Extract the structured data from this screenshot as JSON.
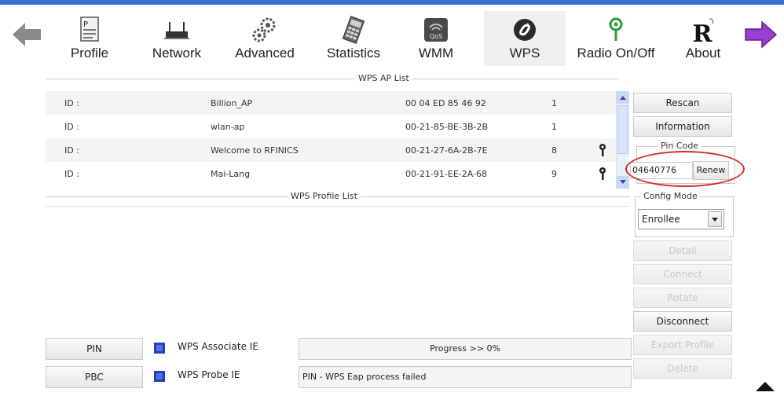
{
  "toolbar": {
    "items": [
      {
        "label": "Profile",
        "icon": "profile-icon"
      },
      {
        "label": "Network",
        "icon": "network-icon"
      },
      {
        "label": "Advanced",
        "icon": "advanced-gears-icon"
      },
      {
        "label": "Statistics",
        "icon": "statistics-icon"
      },
      {
        "label": "WMM",
        "icon": "wmm-qos-icon"
      },
      {
        "label": "WPS",
        "icon": "wps-icon"
      },
      {
        "label": "Radio On/Off",
        "icon": "radio-icon"
      },
      {
        "label": "About",
        "icon": "about-icon"
      }
    ],
    "active": "WPS",
    "icon_text": {
      "wmm": "QoS",
      "about": "R"
    }
  },
  "ap_list": {
    "title": "WPS AP List",
    "rows": [
      {
        "id": "ID :",
        "ssid": "Billion_AP",
        "bssid": "00 04 ED 85 46 92",
        "channel": "1",
        "locked": false
      },
      {
        "id": "ID :",
        "ssid": "wlan-ap",
        "bssid": "00-21-85-BE-3B-2B",
        "channel": "1",
        "locked": false
      },
      {
        "id": "ID :",
        "ssid": "Welcome to RFINICS",
        "bssid": "00-21-27-6A-2B-7E",
        "channel": "8",
        "locked": true
      },
      {
        "id": "ID :",
        "ssid": "Mai-Lang",
        "bssid": "00-21-91-EE-2A-68",
        "channel": "9",
        "locked": true
      }
    ]
  },
  "profile_list": {
    "title": "WPS Profile List"
  },
  "right_panel": {
    "rescan": "Rescan",
    "information": "Information",
    "pin_code_label": "Pin Code",
    "pin_code_value": "04640776",
    "renew": "Renew",
    "config_mode_label": "Config Mode",
    "config_mode_value": "Enrollee",
    "detail": "Detail",
    "connect": "Connect",
    "rotate": "Rotate",
    "disconnect": "Disconnect",
    "export_profile": "Export Profile",
    "delete": "Delete"
  },
  "bottom": {
    "pin_button": "PIN",
    "pbc_button": "PBC",
    "wps_associate_ie": "WPS Associate IE",
    "wps_probe_ie": "WPS Probe IE",
    "progress": "Progress >> 0%",
    "status": "PIN - WPS Eap process failed"
  },
  "colors": {
    "accent": "#3a6fd0",
    "highlight": "#d42b2b",
    "checkbox": "#1f3fb8",
    "forward_arrow": "#9b3fd0"
  }
}
